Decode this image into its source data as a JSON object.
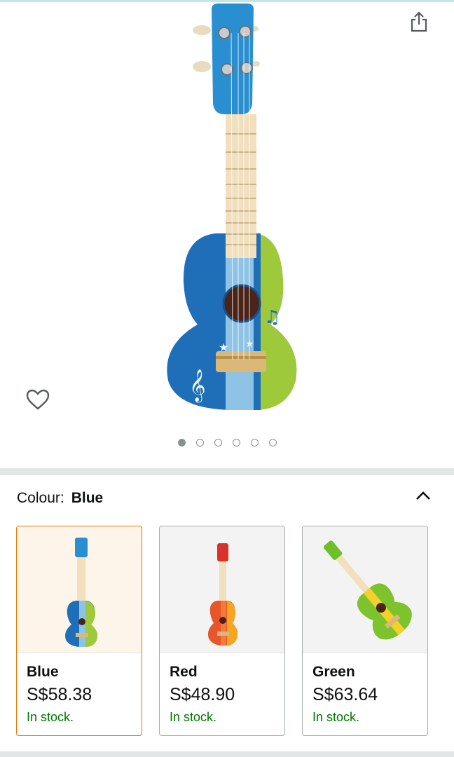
{
  "gallery": {
    "image_count": 6,
    "active_index": 0,
    "icons": {
      "share": "share-icon",
      "wishlist": "heart-outline-icon"
    }
  },
  "colour": {
    "label": "Colour:",
    "selected": "Blue",
    "collapse_icon": "chevron-up-icon",
    "options": [
      {
        "name": "Blue",
        "price": "S$58.38",
        "stock": "In stock.",
        "selected": true
      },
      {
        "name": "Red",
        "price": "S$48.90",
        "stock": "In stock.",
        "selected": false
      },
      {
        "name": "Green",
        "price": "S$63.64",
        "stock": "In stock.",
        "selected": false
      }
    ]
  },
  "colors": {
    "selected_border": "#e77600",
    "in_stock": "#007600",
    "divider": "#e3e6e6",
    "dot": "#8a8f8f"
  }
}
